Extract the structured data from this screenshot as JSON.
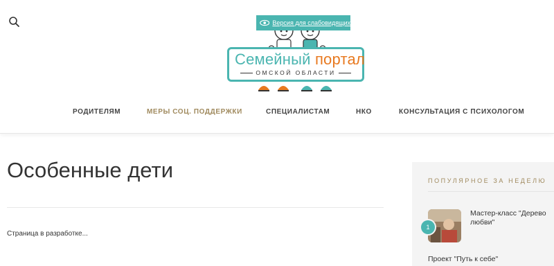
{
  "header": {
    "search_icon": "search-icon",
    "accessibility": {
      "label": "Версия для слабовидящих",
      "icon": "eye-icon"
    },
    "logo": {
      "word1": "Семейный",
      "word2": "портал",
      "subtitle": "ОМСКОЙ ОБЛАСТИ"
    },
    "nav": [
      {
        "label": "РОДИТЕЛЯМ",
        "active": false
      },
      {
        "label": "МЕРЫ СОЦ. ПОДДЕРЖКИ",
        "active": true
      },
      {
        "label": "СПЕЦИАЛИСТАМ",
        "active": false
      },
      {
        "label": "НКО",
        "active": false
      },
      {
        "label": "КОНСУЛЬТАЦИЯ С ПСИХОЛОГОМ",
        "active": false
      }
    ]
  },
  "main": {
    "title": "Особенные дети",
    "body": "Страница в разработке..."
  },
  "sidebar": {
    "widget_title": "ПОПУЛЯРНОЕ ЗА НЕДЕЛЮ",
    "items": [
      {
        "rank": "1",
        "title": "Мастер-класс \"Дерево любви\""
      },
      {
        "title": "Проект \"Путь к себе\""
      }
    ]
  },
  "colors": {
    "accent_teal": "#4ab5b0",
    "accent_orange": "#e8791f",
    "accent_gold": "#a08a5e"
  }
}
